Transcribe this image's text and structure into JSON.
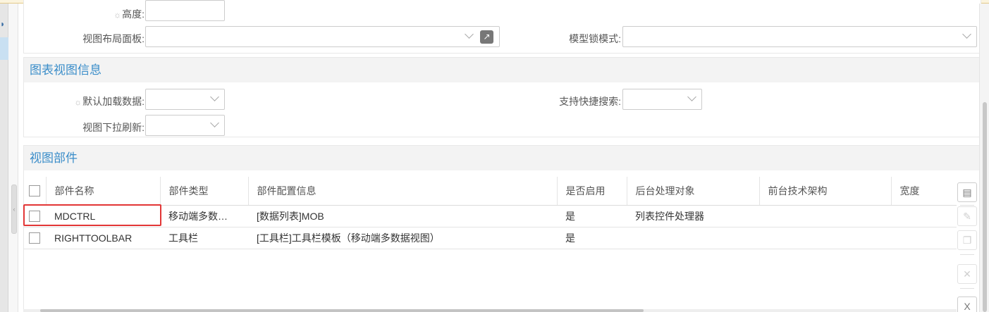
{
  "basic": {
    "height_label": "高度:",
    "height_value": "",
    "layout_panel_label": "视图布局面板:",
    "layout_panel_value": "",
    "lock_mode_label": "模型锁模式:",
    "lock_mode_value": ""
  },
  "chart_info": {
    "title": "图表视图信息",
    "default_load_label": "默认加载数据:",
    "default_load_value": "",
    "quick_search_label": "支持快捷搜索:",
    "quick_search_value": "",
    "pull_refresh_label": "视图下拉刷新:",
    "pull_refresh_value": ""
  },
  "parts": {
    "title": "视图部件",
    "columns": [
      "部件名称",
      "部件类型",
      "部件配置信息",
      "是否启用",
      "后台处理对象",
      "前台技术架构",
      "宽度"
    ],
    "rows": [
      [
        "MDCTRL",
        "移动端多数…",
        "[数据列表]MOB",
        "是",
        "列表控件处理器",
        "",
        ""
      ],
      [
        "RIGHTTOOLBAR",
        "工具栏",
        "[工具栏]工具栏模板（移动端多数据视图）",
        "是",
        "",
        "",
        ""
      ]
    ],
    "highlight_color": "#e23636"
  },
  "toolbar_icons": [
    "new-doc-icon",
    "edit-icon",
    "copy-icon",
    "delete-icon",
    "excel-export-icon"
  ]
}
